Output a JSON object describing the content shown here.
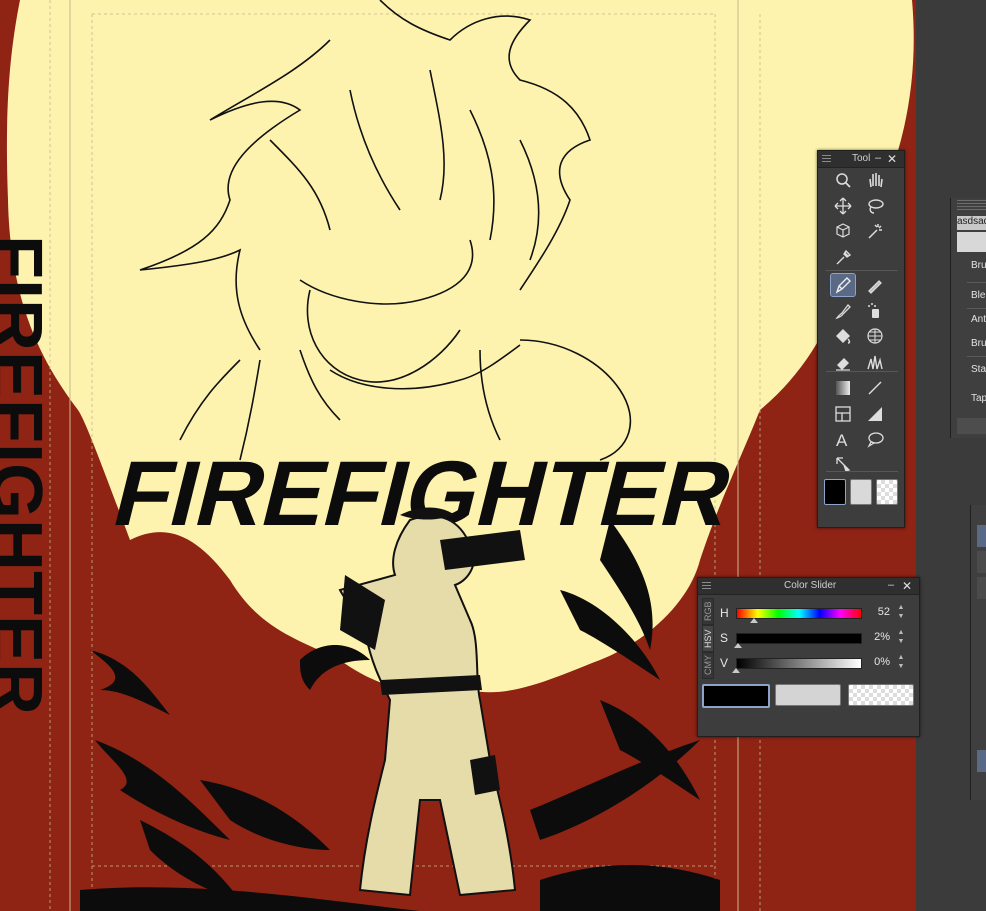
{
  "tool_palette": {
    "title": "Tool",
    "tools": [
      {
        "name": "zoom-icon"
      },
      {
        "name": "hand-icon"
      },
      {
        "name": "move-icon"
      },
      {
        "name": "lasso-icon"
      },
      {
        "name": "object-icon"
      },
      {
        "name": "magic-wand-icon"
      },
      {
        "name": "eyedropper-icon"
      },
      {
        "name": "pen-icon",
        "active": true
      },
      {
        "name": "pencil-icon"
      },
      {
        "name": "brush-icon"
      },
      {
        "name": "airbrush-icon"
      },
      {
        "name": "fill-icon"
      },
      {
        "name": "pattern-icon"
      },
      {
        "name": "eraser-icon"
      },
      {
        "name": "decoration-icon"
      },
      {
        "name": "gradient-icon"
      },
      {
        "name": "line-icon"
      },
      {
        "name": "frame-icon"
      },
      {
        "name": "ruler-icon"
      },
      {
        "name": "text-icon"
      },
      {
        "name": "balloon-icon"
      },
      {
        "name": "correct-line-icon"
      }
    ],
    "main_color": "#000000",
    "sub_color": "#d9d9d9"
  },
  "color_slider": {
    "title": "Color Slider",
    "tabs": [
      "RGB",
      "HSV",
      "CMY"
    ],
    "active_tab": "HSV",
    "channels": [
      {
        "label": "H",
        "value": "52",
        "level": 0.144
      },
      {
        "label": "S",
        "value": "2%",
        "level": 0.02
      },
      {
        "label": "V",
        "value": "0%",
        "level": 0.0
      }
    ],
    "main_color": "#000000",
    "sub_color": "#d4d4d4"
  },
  "brush_panel": {
    "header": "asdsad",
    "items": [
      "Bru",
      "Ble",
      "Ant",
      "Bru",
      "Sta",
      "Tap"
    ]
  },
  "artwork": {
    "headline": "FIREFIGHTER",
    "side_text": "FIREFIGHTER",
    "background_color": "#8f2314",
    "highlight_color": "#fdf3ae"
  }
}
